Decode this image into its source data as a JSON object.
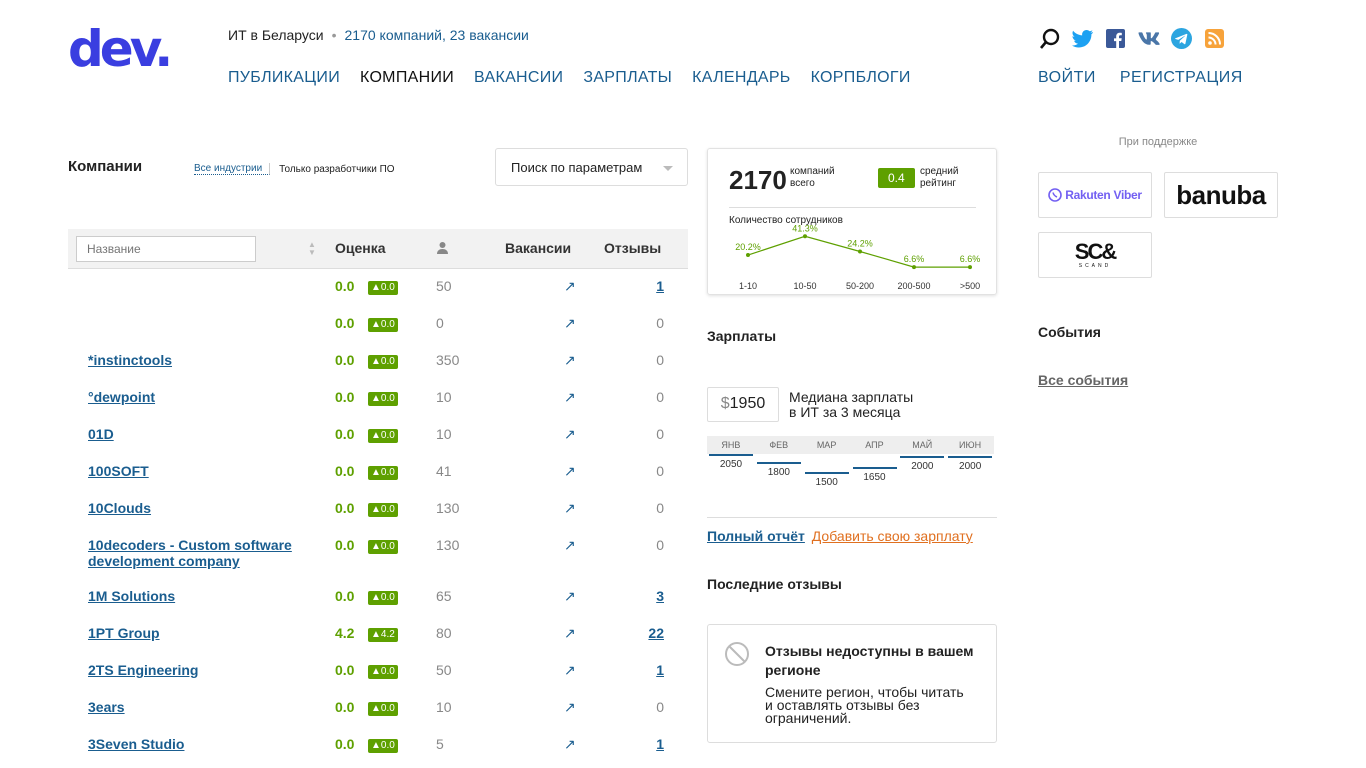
{
  "header": {
    "logo_text": "dev.",
    "region": "ИТ в Беларуси",
    "dot": "•",
    "stats": "2170 компаний, 23 вакансии",
    "nav": [
      {
        "label": "ПУБЛИКАЦИИ",
        "active": false
      },
      {
        "label": "КОМПАНИИ",
        "active": true
      },
      {
        "label": "ВАКАНСИИ",
        "active": false
      },
      {
        "label": "ЗАРПЛАТЫ",
        "active": false
      },
      {
        "label": "КАЛЕНДАРЬ",
        "active": false
      },
      {
        "label": "КОРПБЛОГИ",
        "active": false
      }
    ],
    "login": "ВОЙТИ",
    "register": "РЕГИСТРАЦИЯ",
    "social_icons": [
      "search-icon",
      "twitter-icon",
      "facebook-icon",
      "vk-icon",
      "telegram-icon",
      "rss-icon"
    ]
  },
  "companies": {
    "title": "Компании",
    "filter_all": "Все индустрии",
    "filter_dev": "Только разработчики ПО",
    "search_params": "Поиск по параметрам",
    "name_placeholder": "Название",
    "col_rating": "Оценка",
    "col_vacancies": "Вакансии",
    "col_reviews": "Отзывы",
    "vacancy_icon": "↗",
    "rows": [
      {
        "name": "",
        "score": "0.0",
        "badge": "▲0.0",
        "employees": "50",
        "reviews": "1",
        "reviews_link": true
      },
      {
        "name": "",
        "score": "0.0",
        "badge": "▲0.0",
        "employees": "0",
        "reviews": "0",
        "reviews_link": false
      },
      {
        "name": "*instinctools",
        "score": "0.0",
        "badge": "▲0.0",
        "employees": "350",
        "reviews": "0",
        "reviews_link": false
      },
      {
        "name": "°dewpoint",
        "score": "0.0",
        "badge": "▲0.0",
        "employees": "10",
        "reviews": "0",
        "reviews_link": false
      },
      {
        "name": "01D",
        "score": "0.0",
        "badge": "▲0.0",
        "employees": "10",
        "reviews": "0",
        "reviews_link": false
      },
      {
        "name": "100SOFT",
        "score": "0.0",
        "badge": "▲0.0",
        "employees": "41",
        "reviews": "0",
        "reviews_link": false
      },
      {
        "name": "10Clouds",
        "score": "0.0",
        "badge": "▲0.0",
        "employees": "130",
        "reviews": "0",
        "reviews_link": false
      },
      {
        "name": "10decoders - Custom software development company",
        "score": "0.0",
        "badge": "▲0.0",
        "employees": "130",
        "reviews": "0",
        "reviews_link": false
      },
      {
        "name": "1M Solutions",
        "score": "0.0",
        "badge": "▲0.0",
        "employees": "65",
        "reviews": "3",
        "reviews_link": true
      },
      {
        "name": "1PT Group",
        "score": "4.2",
        "badge": "▲4.2",
        "employees": "80",
        "reviews": "22",
        "reviews_link": true
      },
      {
        "name": "2TS Engineering",
        "score": "0.0",
        "badge": "▲0.0",
        "employees": "50",
        "reviews": "1",
        "reviews_link": true
      },
      {
        "name": "3ears",
        "score": "0.0",
        "badge": "▲0.0",
        "employees": "10",
        "reviews": "0",
        "reviews_link": false
      },
      {
        "name": "3Seven Studio",
        "score": "0.0",
        "badge": "▲0.0",
        "employees": "5",
        "reviews": "1",
        "reviews_link": true
      }
    ]
  },
  "stats_box": {
    "total": "2170",
    "total_label_1": "компаний",
    "total_label_2": "всего",
    "rating": "0.4",
    "rating_label_1": "средний",
    "rating_label_2": "рейтинг",
    "employees_label": "Количество сотрудников"
  },
  "chart_data": {
    "type": "line",
    "title": "Количество сотрудников",
    "categories": [
      "1-10",
      "10-50",
      "50-200",
      "200-500",
      ">500"
    ],
    "values": [
      20.2,
      41.3,
      24.2,
      6.6,
      6.6
    ],
    "value_labels": [
      "20.2%",
      "41.3%",
      "24.2%",
      "6.6%",
      "6.6%"
    ],
    "ylim": [
      0,
      45
    ],
    "color": "#5ea000"
  },
  "salary": {
    "title": "Зарплаты",
    "currency": "$",
    "median": "1950",
    "median_text_1": "Медиана зарплаты",
    "median_text_2": "в ИТ за 3 месяца",
    "months": [
      "ЯНВ",
      "ФЕВ",
      "МАР",
      "АПР",
      "МАЙ",
      "ИЮН"
    ],
    "values": [
      "2050",
      "1800",
      "1500",
      "1650",
      "2000",
      "2000"
    ],
    "value_nums": [
      2050,
      1800,
      1500,
      1650,
      2000,
      2000
    ],
    "full_report": "Полный отчёт",
    "add_salary": "Добавить свою зарплату"
  },
  "reviews": {
    "title": "Последние отзывы",
    "unavailable_title": "Отзывы недоступны в вашем регионе",
    "unavailable_text": "Смените регион, чтобы читать и оставлять отзывы без ограничений."
  },
  "sidebar": {
    "support": "При поддержке",
    "sponsors": [
      "Rakuten Viber",
      "banuba",
      "SC&"
    ],
    "sponsor_sub": "SCAND",
    "events_title": "События",
    "all_events": "Все события"
  }
}
